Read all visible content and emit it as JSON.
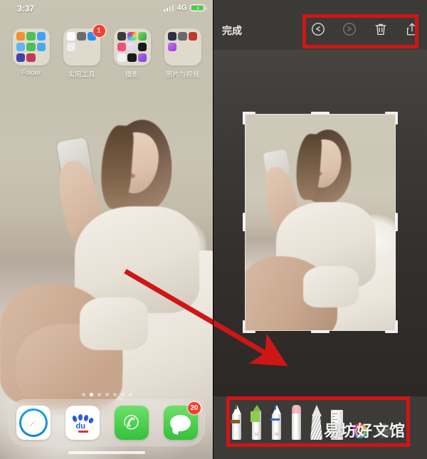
{
  "left_panel": {
    "status_bar": {
      "time": "3:37",
      "network": "4G",
      "signal_icon": "signal-bars-icon",
      "battery_icon": "battery-charging-icon"
    },
    "folders": [
      {
        "label": "Folder",
        "badge": "",
        "icon_colors": [
          "#f2922e",
          "#4cc05a",
          "#3fa2f7",
          "#3fa2f7",
          "#4cc05a",
          "#3fa2f7",
          "#4b3fa8",
          "#c0395a"
        ]
      },
      {
        "label": "实用工具",
        "badge": "1",
        "icon_colors": [
          "#ffffff",
          "#6b6b6b",
          "#2f8bf0",
          "#eeeeee"
        ]
      },
      {
        "label": "摄影",
        "badge": "",
        "icon_colors": [
          "#3a3a3a",
          "#f25c9b",
          "#7ed957",
          "#f0507a",
          "#e9e0f2",
          "#1a1a1a",
          "#f0f0f0",
          "#1a1a1a",
          "#9b5cf0"
        ]
      },
      {
        "label": "照片与视频",
        "badge": "",
        "icon_colors": [
          "#2f2f46",
          "#5a5a5a",
          "#c0392b",
          "#b44bd8"
        ]
      }
    ],
    "page_dots": {
      "count": 7,
      "active_index": 1
    },
    "dock": [
      {
        "label": "Safari",
        "icon": "safari-compass-icon",
        "badge": ""
      },
      {
        "label": "Baidu",
        "icon": "baidu-paw-icon",
        "badge": ""
      },
      {
        "label": "Phone",
        "icon": "phone-handset-icon",
        "badge": ""
      },
      {
        "label": "Messages",
        "icon": "message-bubble-icon",
        "badge": "20"
      }
    ]
  },
  "right_panel": {
    "topbar": {
      "done_label": "完成",
      "actions": [
        {
          "name": "undo-icon",
          "state": "enabled"
        },
        {
          "name": "redo-icon",
          "state": "disabled"
        },
        {
          "name": "trash-icon",
          "state": "enabled"
        },
        {
          "name": "share-icon",
          "state": "enabled"
        }
      ]
    },
    "crop": {
      "handles": "corner-and-edge-handles"
    },
    "markup_tools": [
      {
        "name": "pen-tool",
        "color": "#8a5a2b",
        "size_label": ""
      },
      {
        "name": "highlighter-tool",
        "color": "#7ac143",
        "size_label": "52"
      },
      {
        "name": "marker-tool",
        "color": "#2f6fd0",
        "size_label": "59"
      },
      {
        "name": "eraser-tool",
        "color": "#e8a6a6",
        "size_label": ""
      },
      {
        "name": "lasso-tool",
        "color": "#e8e8e8",
        "size_label": ""
      },
      {
        "name": "ruler-tool",
        "color": "#f0f0f0",
        "size_label": ""
      }
    ],
    "color_wheel": {
      "name": "color-wheel",
      "selected_color": "#a8572a"
    },
    "add_button": {
      "name": "add-tool-button",
      "label": "+"
    }
  },
  "annotations": {
    "highlight_boxes": [
      {
        "name": "toolbar-highlight-box",
        "color": "#cf1616"
      },
      {
        "name": "markup-tray-highlight-box",
        "color": "#cf1616"
      }
    ],
    "arrow": {
      "name": "guide-arrow",
      "color": "#cf1616"
    }
  },
  "watermark": {
    "text": "易坊好文馆"
  }
}
